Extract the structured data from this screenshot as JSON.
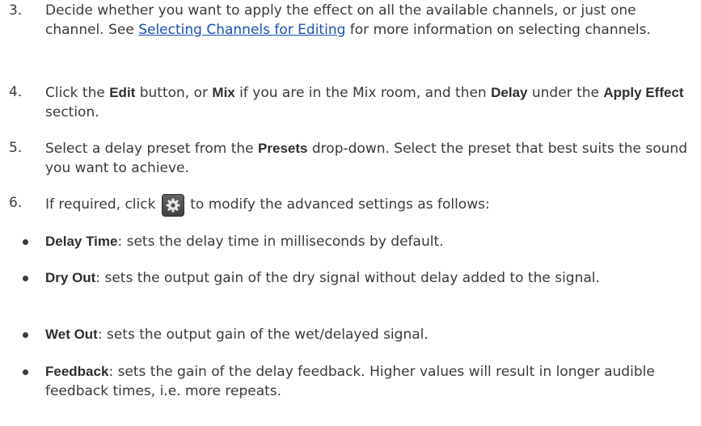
{
  "steps": [
    {
      "num": "3.",
      "before": "Decide whether you want to apply the effect on all the available channels, or just one channel. See ",
      "link": "Selecting Channels for Editing",
      "after": " for more information on selecting channels."
    },
    {
      "num": "4.",
      "t1": "Click the ",
      "b1": "Edit",
      "t2": " button, or ",
      "b2": "Mix",
      "t3": " if you are in the Mix room, and then ",
      "b3": "Delay",
      "t4": " under the ",
      "b4": "Apply Effect",
      "t5": " section."
    },
    {
      "num": "5.",
      "t1": "Select a delay preset from the ",
      "b1": "Presets",
      "t2": " drop-down. Select the preset that best suits the sound you want to achieve."
    },
    {
      "num": "6.",
      "before": "If required, click ",
      "icon": "gear-icon",
      "after": " to modify the advanced settings as follows:"
    }
  ],
  "bullets": [
    {
      "term": "Delay Time",
      "desc": ": sets the delay time in milliseconds by default."
    },
    {
      "term": "Dry Out",
      "desc": ": sets the output gain of the dry signal without delay added to the signal."
    },
    {
      "term": "Wet Out",
      "desc": ": sets the output gain of the wet/delayed signal."
    },
    {
      "term": "Feedback",
      "desc": ": sets the gain of the delay feedback. Higher values will result in longer audible feedback times, i.e. more repeats."
    }
  ]
}
